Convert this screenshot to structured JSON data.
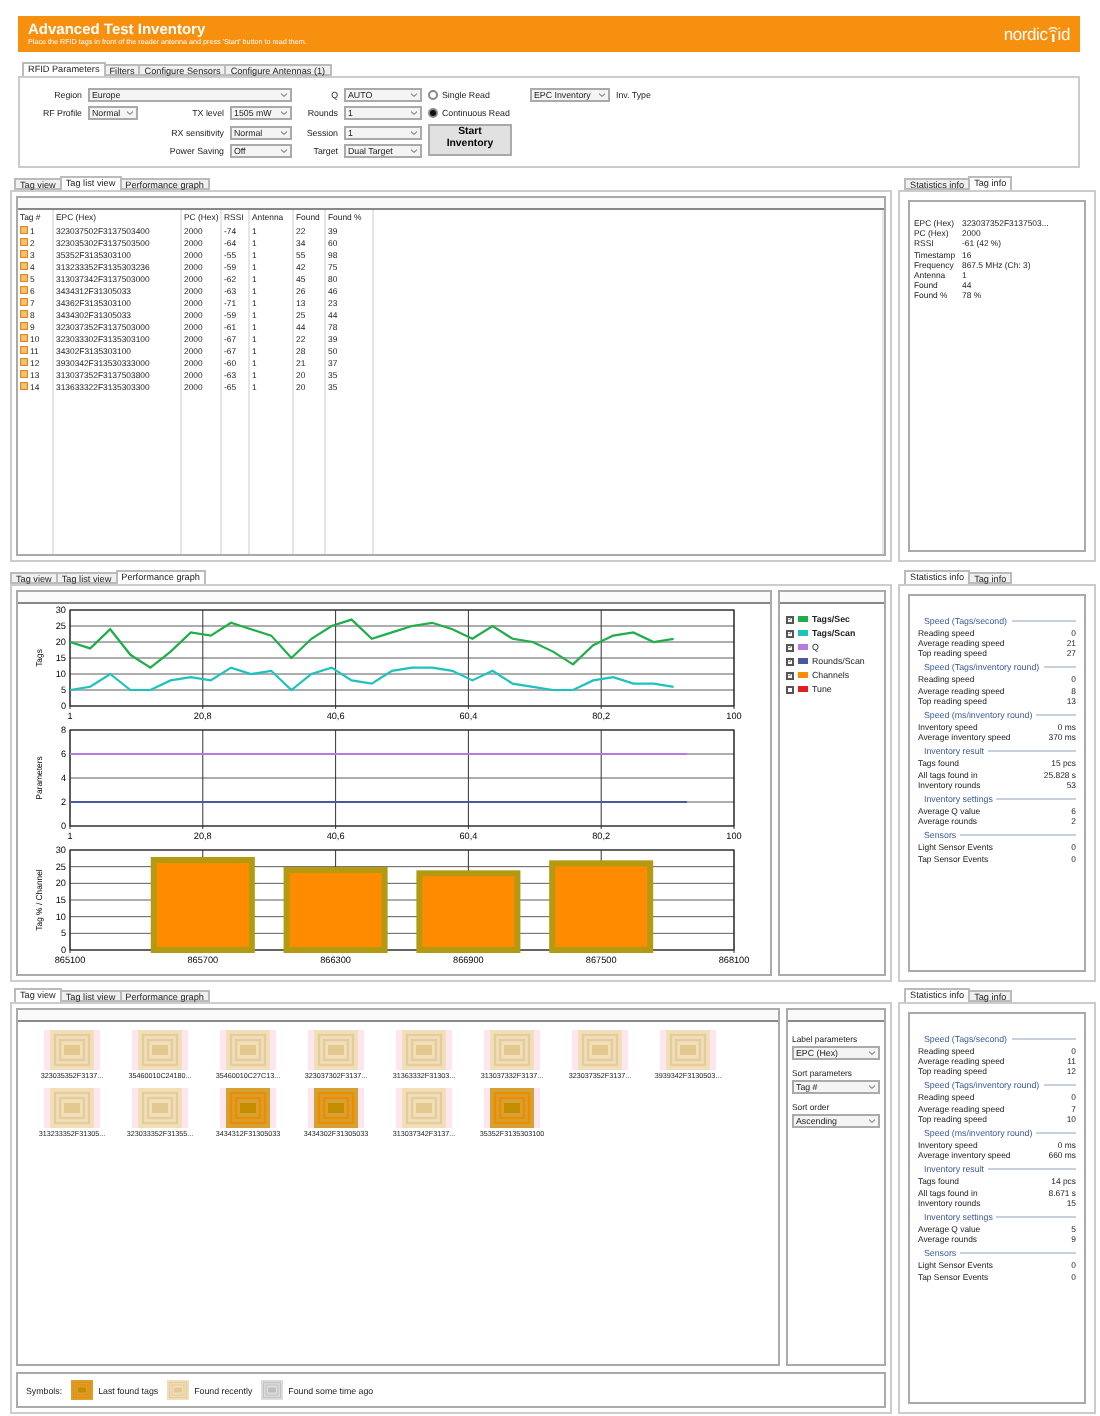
{
  "header": {
    "title": "Advanced Test Inventory",
    "subtitle": "Place the RFID tags in front of the reader antenna and press 'Start' button to read them.",
    "logo_left": "nordic",
    "logo_right": "id"
  },
  "config_tabs": [
    {
      "label": "RFID Parameters",
      "selected": true
    },
    {
      "label": "Filters",
      "selected": false
    },
    {
      "label": "Configure Sensors",
      "selected": false
    },
    {
      "label": "Configure Antennas (1)",
      "selected": false
    }
  ],
  "rfid_parameters": {
    "fields": [
      {
        "label": "Region",
        "value": "Europe"
      },
      {
        "label": "RF Profile",
        "value": "Normal"
      },
      {
        "label": "TX level",
        "value": "1505 mW"
      },
      {
        "label": "RX sensitivity",
        "value": "Normal"
      },
      {
        "label": "Power Saving",
        "value": "Off"
      },
      {
        "label": "Q",
        "value": "AUTO"
      },
      {
        "label": "Rounds",
        "value": "1"
      },
      {
        "label": "Session",
        "value": "1"
      },
      {
        "label": "Target",
        "value": "Dual Target"
      }
    ],
    "read_modes": [
      {
        "label": "Single Read",
        "selected": false
      },
      {
        "label": "Continuous Read",
        "selected": true
      }
    ],
    "inventory_type": {
      "value": "EPC Inventory",
      "label": "Inv. Type"
    },
    "start_button": "Start Inventory"
  },
  "tag_list_section": {
    "view_tabs": [
      {
        "label": "Tag view",
        "selected": false
      },
      {
        "label": "Tag list view",
        "selected": true
      },
      {
        "label": "Performance graph",
        "selected": false
      }
    ],
    "columns": [
      "Tag #",
      "EPC (Hex)",
      "PC (Hex)",
      "RSSI",
      "Antenna",
      "Found",
      "Found %"
    ],
    "rows": [
      [
        "1",
        "323037502F3137503400",
        "2000",
        "-74",
        "1",
        "22",
        "39"
      ],
      [
        "2",
        "323035302F3137503500",
        "2000",
        "-64",
        "1",
        "34",
        "60"
      ],
      [
        "3",
        "35352F3135303100",
        "2000",
        "-55",
        "1",
        "55",
        "98"
      ],
      [
        "4",
        "313233352F3135303236",
        "2000",
        "-59",
        "1",
        "42",
        "75"
      ],
      [
        "5",
        "313037342F3137503000",
        "2000",
        "-62",
        "1",
        "45",
        "80"
      ],
      [
        "6",
        "3434312F31305033",
        "2000",
        "-63",
        "1",
        "26",
        "46"
      ],
      [
        "7",
        "34362F3135303100",
        "2000",
        "-71",
        "1",
        "13",
        "23"
      ],
      [
        "8",
        "3434302F31305033",
        "2000",
        "-59",
        "1",
        "25",
        "44"
      ],
      [
        "9",
        "323037352F3137503000",
        "2000",
        "-61",
        "1",
        "44",
        "78"
      ],
      [
        "10",
        "323033302F3135303100",
        "2000",
        "-67",
        "1",
        "22",
        "39"
      ],
      [
        "11",
        "34302F3135303100",
        "2000",
        "-67",
        "1",
        "28",
        "50"
      ],
      [
        "12",
        "3930342F313530333000",
        "2000",
        "-60",
        "1",
        "21",
        "37"
      ],
      [
        "13",
        "313037352F3137503800",
        "2000",
        "-63",
        "1",
        "20",
        "35"
      ],
      [
        "14",
        "313633322F3135303300",
        "2000",
        "-65",
        "1",
        "20",
        "35"
      ]
    ],
    "info_tabs": [
      {
        "label": "Statistics info",
        "selected": false
      },
      {
        "label": "Tag info",
        "selected": true
      }
    ],
    "tag_info": [
      {
        "label": "EPC (Hex)",
        "value": "323037352F3137503..."
      },
      {
        "label": "PC (Hex)",
        "value": "2000"
      },
      {
        "label": "RSSI",
        "value": "-61 (42 %)"
      },
      {
        "label": "Timestamp",
        "value": "16"
      },
      {
        "label": "Frequency",
        "value": "867.5 MHz (Ch: 3)"
      },
      {
        "label": "Antenna",
        "value": "1"
      },
      {
        "label": "Found",
        "value": "44"
      },
      {
        "label": "Found %",
        "value": "78 %"
      }
    ]
  },
  "graph_section": {
    "view_tabs": [
      {
        "label": "Tag view",
        "selected": false
      },
      {
        "label": "Tag list view",
        "selected": false
      },
      {
        "label": "Performance graph",
        "selected": true
      }
    ],
    "charts": [
      {
        "chart_data": {
          "type": "line",
          "ylabel": "Tags",
          "grid": true,
          "x": [
            1,
            4,
            7,
            10,
            13,
            16,
            19,
            22,
            25,
            28,
            31,
            34,
            37,
            40,
            43,
            46,
            49,
            52,
            55,
            58,
            61,
            64,
            67,
            70,
            73,
            76,
            79,
            82,
            85,
            88,
            91
          ],
          "xlim": [
            1,
            100
          ],
          "ylim": [
            0,
            30
          ],
          "xticks": [
            1,
            {
              "value": 20.8,
              "label": "20,8"
            },
            {
              "value": 40.6,
              "label": "40,6"
            },
            {
              "value": 60.4,
              "label": "60,4"
            },
            {
              "value": 80.2,
              "label": "80,2"
            },
            100
          ],
          "yticks": [
            0,
            5,
            10,
            15,
            20,
            25,
            30
          ],
          "series": [
            {
              "name": "Tags/Sec",
              "color": "#1fae4a",
              "values": [
                20,
                18,
                24,
                16,
                12,
                17,
                23,
                22,
                26,
                24,
                22,
                15,
                21,
                25,
                27,
                21,
                23,
                25,
                26,
                24,
                21,
                25,
                21,
                20,
                17,
                13,
                19,
                22,
                23,
                20,
                21
              ]
            },
            {
              "name": "Tags/Scan",
              "color": "#1cc2bc",
              "values": [
                5,
                6,
                10,
                5,
                5,
                8,
                9,
                8,
                12,
                10,
                11,
                5,
                10,
                12,
                8,
                7,
                11,
                12,
                12,
                11,
                8,
                11,
                7,
                6,
                5,
                5,
                8,
                9,
                7,
                7,
                6
              ]
            }
          ]
        }
      },
      {
        "chart_data": {
          "type": "line",
          "ylabel": "Parameters",
          "grid": true,
          "x": [
            1,
            93
          ],
          "xlim": [
            1,
            100
          ],
          "ylim": [
            0,
            8
          ],
          "xticks": [
            1,
            {
              "value": 20.8,
              "label": "20,8"
            },
            {
              "value": 40.6,
              "label": "40,6"
            },
            {
              "value": 60.4,
              "label": "60,4"
            },
            {
              "value": 80.2,
              "label": "80,2"
            },
            100
          ],
          "yticks": [
            0,
            2,
            4,
            6,
            8
          ],
          "series": [
            {
              "name": "Q",
              "color": "#b57be0",
              "values": [
                6,
                6
              ]
            },
            {
              "name": "Rounds/Scan",
              "color": "#4a5a9c",
              "values": [
                2,
                2
              ]
            }
          ]
        }
      },
      {
        "chart_data": {
          "type": "bar",
          "ylabel": "Tag % / Channel",
          "x": [
            865700,
            866300,
            866900,
            867500
          ],
          "xlim": [
            865100,
            868100
          ],
          "ylim": [
            0,
            30
          ],
          "xticks": [
            865100,
            865700,
            866300,
            866900,
            867500,
            868100
          ],
          "yticks": [
            0,
            5,
            10,
            15,
            20,
            25,
            30
          ],
          "grid": true,
          "series": [
            {
              "name": "Channels",
              "color": "#ff8c00",
              "values": [
                27,
                24,
                23,
                26
              ]
            }
          ]
        }
      }
    ],
    "legend": [
      {
        "checked": true,
        "bold": true
      },
      {
        "checked": true,
        "bold": true
      },
      {
        "checked": true,
        "bold": false
      },
      {
        "checked": true,
        "bold": false
      },
      {
        "checked": true,
        "bold": false
      },
      {
        "label": "Tune",
        "color": "#e02020",
        "checked": false,
        "bold": false
      }
    ],
    "info_tabs": [
      {
        "label": "Statistics info",
        "selected": true
      },
      {
        "label": "Tag info",
        "selected": false
      }
    ],
    "statistics": [
      {
        "title": "Speed (Tags/second)",
        "rows": [
          {
            "label": "Reading speed",
            "value": "0"
          },
          {
            "label": "Average reading speed",
            "value": "21"
          },
          {
            "label": "Top reading speed",
            "value": "27"
          }
        ]
      },
      {
        "title": "Speed (Tags/inventory round)",
        "rows": [
          {
            "label": "Reading speed",
            "value": "0"
          },
          {
            "label": "Average reading speed",
            "value": "8"
          },
          {
            "label": "Top reading speed",
            "value": "13"
          }
        ]
      },
      {
        "title": "Speed (ms/inventory round)",
        "rows": [
          {
            "label": "Inventory speed",
            "value": "0 ms"
          },
          {
            "label": "Average inventory speed",
            "value": "370 ms"
          }
        ]
      },
      {
        "title": "Inventory result",
        "rows": [
          {
            "label": "Tags found",
            "value": "15 pcs"
          },
          {
            "label": "All tags found in",
            "value": "25.828 s"
          },
          {
            "label": "Inventory rounds",
            "value": "53"
          }
        ]
      },
      {
        "title": "Inventory settings",
        "rows": [
          {
            "label": "Average Q value",
            "value": "6"
          },
          {
            "label": "Average rounds",
            "value": "2"
          }
        ]
      },
      {
        "title": "Sensors",
        "rows": [
          {
            "label": "Light Sensor Events",
            "value": "0"
          },
          {
            "label": "Tap Sensor Events",
            "value": "0"
          }
        ]
      }
    ]
  },
  "tag_view_section": {
    "view_tabs": [
      {
        "label": "Tag view",
        "selected": true
      },
      {
        "label": "Tag list view",
        "selected": false
      },
      {
        "label": "Performance graph",
        "selected": false
      }
    ],
    "tags": [
      {
        "label": "323035352F3137...",
        "kind": "recent"
      },
      {
        "label": "35460010C24180...",
        "kind": "recent"
      },
      {
        "label": "35460010C27C13...",
        "kind": "recent"
      },
      {
        "label": "323037302F3137...",
        "kind": "recent"
      },
      {
        "label": "31363332F31303...",
        "kind": "recent"
      },
      {
        "label": "313037332F3137...",
        "kind": "recent"
      },
      {
        "label": "323037352F3137...",
        "kind": "recent"
      },
      {
        "label": "3939342F3130503...",
        "kind": "recent"
      },
      {
        "label": "313233352F31305...",
        "kind": "recent"
      },
      {
        "label": "323033352F31355...",
        "kind": "recent"
      },
      {
        "label": "3434312F31305033",
        "kind": "last"
      },
      {
        "label": "3434302F31305033",
        "kind": "last"
      },
      {
        "label": "313037342F3137...",
        "kind": "recent"
      },
      {
        "label": "35352F3135303100",
        "kind": "last"
      }
    ],
    "view_options": [
      {
        "label": "Label parameters",
        "value": "EPC (Hex)"
      },
      {
        "label": "Sort parameters",
        "value": "Tag #"
      },
      {
        "label": "Sort order",
        "value": "Ascending"
      }
    ],
    "symbols": {
      "label": "Symbols:",
      "items": [
        {
          "label": "Last found tags",
          "kind": "last"
        },
        {
          "label": "Found recently",
          "kind": "recent"
        },
        {
          "label": "Found some time ago",
          "kind": "old"
        }
      ]
    },
    "info_tabs": [
      {
        "label": "Statistics info",
        "selected": true
      },
      {
        "label": "Tag info",
        "selected": false
      }
    ],
    "statistics": [
      {
        "title": "Speed (Tags/second)",
        "rows": [
          {
            "label": "Reading speed",
            "value": "0"
          },
          {
            "label": "Average reading speed",
            "value": "11"
          },
          {
            "label": "Top reading speed",
            "value": "12"
          }
        ]
      },
      {
        "title": "Speed (Tags/inventory round)",
        "rows": [
          {
            "label": "Reading speed",
            "value": "0"
          },
          {
            "label": "Average reading speed",
            "value": "7"
          },
          {
            "label": "Top reading speed",
            "value": "10"
          }
        ]
      },
      {
        "title": "Speed (ms/inventory round)",
        "rows": [
          {
            "label": "Inventory speed",
            "value": "0 ms"
          },
          {
            "label": "Average inventory speed",
            "value": "660 ms"
          }
        ]
      },
      {
        "title": "Inventory result",
        "rows": [
          {
            "label": "Tags found",
            "value": "14 pcs"
          },
          {
            "label": "All tags found in",
            "value": "8.671 s"
          },
          {
            "label": "Inventory rounds",
            "value": "15"
          }
        ]
      },
      {
        "title": "Inventory settings",
        "rows": [
          {
            "label": "Average Q value",
            "value": "5"
          },
          {
            "label": "Average rounds",
            "value": "9"
          }
        ]
      },
      {
        "title": "Sensors",
        "rows": [
          {
            "label": "Light Sensor Events",
            "value": "0"
          },
          {
            "label": "Tap Sensor Events",
            "value": "0"
          }
        ]
      }
    ]
  }
}
